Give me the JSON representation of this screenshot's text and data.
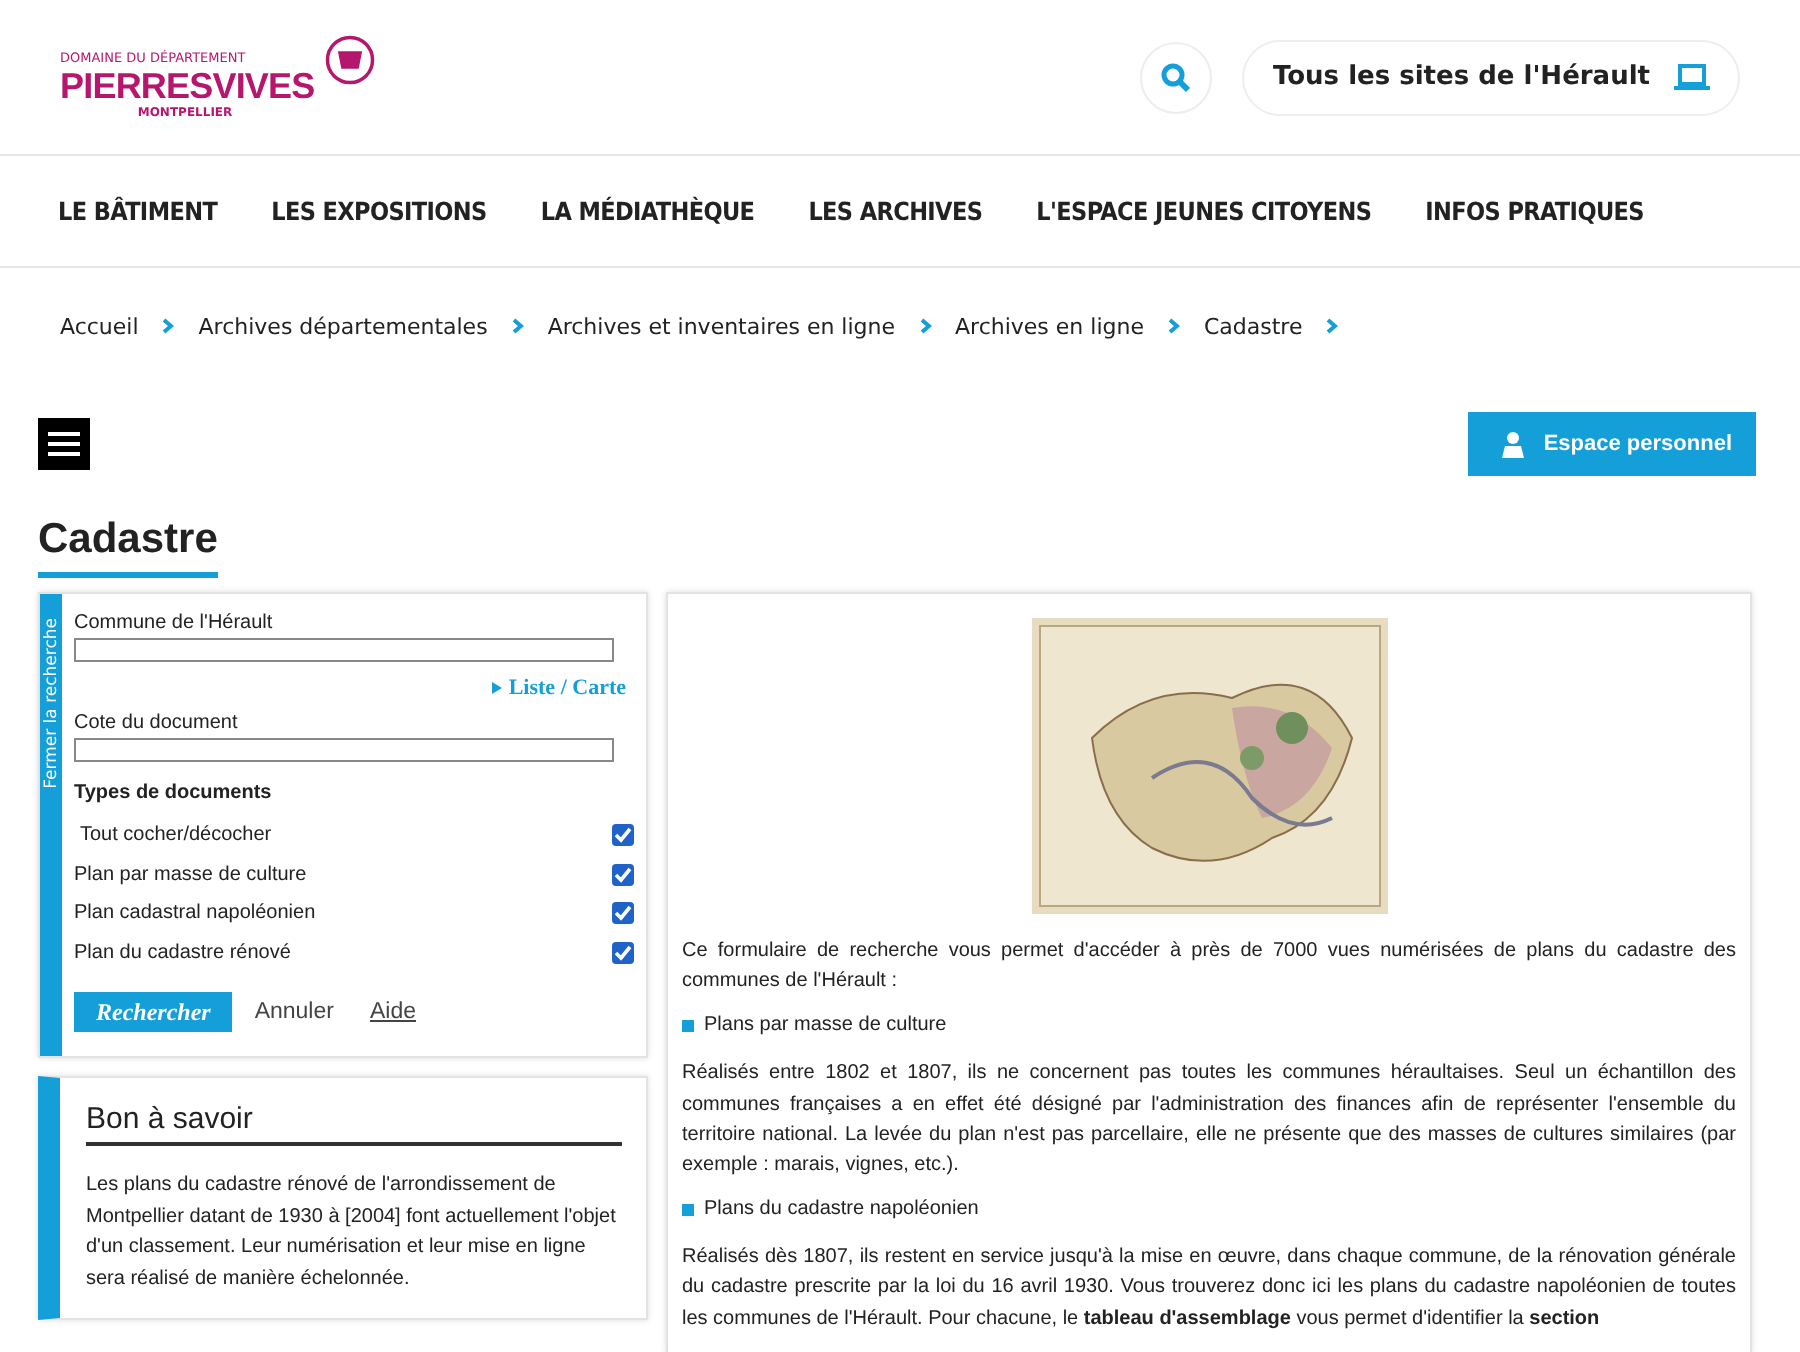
{
  "logo": {
    "tagline": "DOMAINE DU DÉPARTEMENT",
    "name": "PIERRESVIVES",
    "city": "MONTPELLIER"
  },
  "header": {
    "sites_button": "Tous les sites de l'Hérault"
  },
  "nav": [
    "LE BÂTIMENT",
    "LES EXPOSITIONS",
    "LA MÉDIATHÈQUE",
    "LES ARCHIVES",
    "L'ESPACE JEUNES CITOYENS",
    "INFOS PRATIQUES"
  ],
  "breadcrumb": [
    "Accueil",
    "Archives départementales",
    "Archives et inventaires en ligne",
    "Archives en ligne",
    "Cadastre"
  ],
  "account_button": "Espace personnel",
  "page_title": "Cadastre",
  "search_panel": {
    "side_tab": "Fermer la recherche",
    "fields": [
      {
        "label": "Commune de l'Hérault"
      },
      {
        "label": "Cote du document"
      }
    ],
    "list_link": "Liste / Carte",
    "types_title": "Types de documents",
    "types": [
      {
        "label": "Tout cocher/décocher",
        "checked": true
      },
      {
        "label": "Plan par masse de culture",
        "checked": true
      },
      {
        "label": "Plan cadastral napoléonien",
        "checked": true
      },
      {
        "label": "Plan du cadastre rénové",
        "checked": true
      }
    ],
    "search_button": "Rechercher",
    "cancel": "Annuler",
    "help": "Aide"
  },
  "info_box": {
    "title": "Bon à savoir",
    "text": "Les plans du cadastre rénové de l'arrondissement de Montpellier datant de 1930 à [2004] font actuellement l'objet d'un classement. Leur numérisation et leur mise en ligne sera réalisé de manière échelonnée."
  },
  "content": [
    {
      "kind": "paragraph",
      "text": "Ce formulaire de recherche vous permet d'accéder à près de 7000 vues numérisées de plans du cadastre des communes de l'Hérault :"
    },
    {
      "kind": "bullet",
      "text": "Plans par masse de culture"
    },
    {
      "kind": "paragraph",
      "text": "Réalisés entre 1802 et 1807, ils ne concernent pas toutes les communes héraultaises. Seul un échantillon des communes françaises a en effet été désigné par l'administration des finances afin de représenter l'ensemble du territoire national. La levée du plan n'est pas parcellaire, elle ne présente que des masses de cultures similaires (par exemple : marais, vignes, etc.)."
    },
    {
      "kind": "bullet",
      "text": "Plans du cadastre napoléonien"
    },
    {
      "kind": "paragraph",
      "text": "Réalisés dès 1807, ils restent en service jusqu'à la mise en œuvre, dans chaque commune, de la rénovation générale du cadastre prescrite par la loi du 16 avril 1930. Vous trouverez donc ici les plans du cadastre napoléonien de toutes les communes de l'Hérault. Pour chacune, le **tableau d'assemblage** vous permet d'identifier la **section**"
    }
  ]
}
